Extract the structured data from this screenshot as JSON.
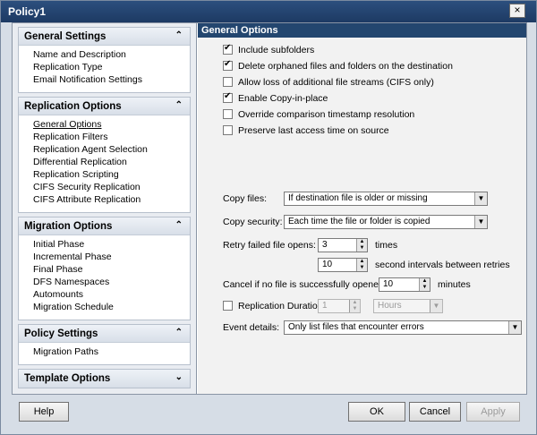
{
  "window": {
    "title": "Policy1",
    "close_label": "×"
  },
  "sidebar": {
    "sections": [
      {
        "title": "General Settings",
        "chevron": "⌃",
        "items": [
          "Name and Description",
          "Replication Type",
          "Email Notification Settings"
        ]
      },
      {
        "title": "Replication Options",
        "chevron": "⌃",
        "items": [
          "General Options",
          "Replication Filters",
          "Replication Agent Selection",
          "Differential Replication",
          "Replication Scripting",
          "CIFS Security Replication",
          "CIFS Attribute Replication"
        ]
      },
      {
        "title": "Migration Options",
        "chevron": "⌃",
        "items": [
          "Initial Phase",
          "Incremental Phase",
          "Final Phase",
          "DFS Namespaces",
          "Automounts",
          "Migration Schedule"
        ]
      },
      {
        "title": "Policy Settings",
        "chevron": "⌃",
        "items": [
          "Migration Paths"
        ]
      },
      {
        "title": "Template Options",
        "chevron": "⌄",
        "items": []
      }
    ]
  },
  "main": {
    "header": "General Options",
    "checkboxes": [
      {
        "label": "Include subfolders",
        "checked": true
      },
      {
        "label": "Delete orphaned files and folders on the destination",
        "checked": true
      },
      {
        "label": "Allow loss of additional file streams (CIFS only)",
        "checked": false
      },
      {
        "label": "Enable Copy-in-place",
        "checked": true
      },
      {
        "label": "Override comparison timestamp resolution",
        "checked": false
      },
      {
        "label": "Preserve last access time on source",
        "checked": false
      }
    ],
    "copy_files": {
      "label": "Copy files:",
      "value": "If destination file is older or missing"
    },
    "copy_security": {
      "label": "Copy security:",
      "value": "Each time the file or folder is copied"
    },
    "retry": {
      "label": "Retry failed file opens:",
      "times_value": "3",
      "times_label": "times",
      "interval_value": "10",
      "interval_label": "second intervals between retries"
    },
    "cancel": {
      "label": "Cancel if no file is successfully opened in",
      "value": "10",
      "unit": "minutes"
    },
    "duration": {
      "label": "Replication Duration",
      "checked": false,
      "value": "1",
      "unit": "Hours"
    },
    "event": {
      "label": "Event details:",
      "value": "Only list files that encounter errors"
    }
  },
  "footer": {
    "help": "Help",
    "ok": "OK",
    "cancel": "Cancel",
    "apply": "Apply"
  }
}
